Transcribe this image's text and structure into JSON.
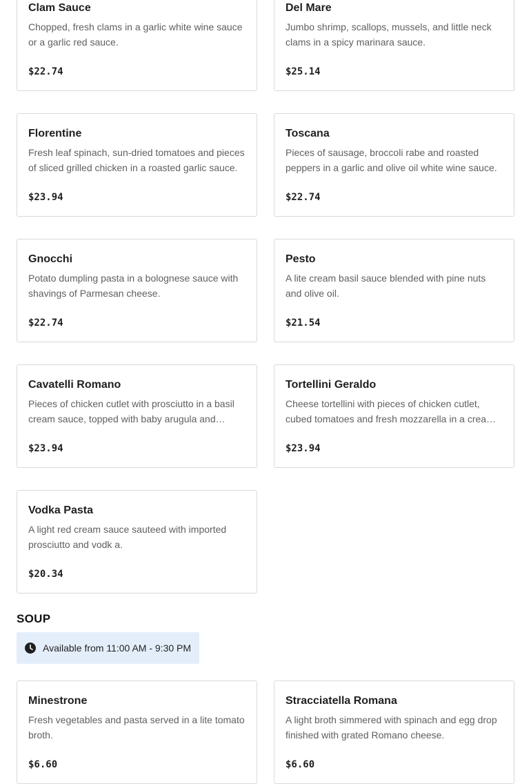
{
  "pasta_items": [
    {
      "name": "Clam Sauce",
      "description": "Chopped, fresh clams in a garlic white wine sauce or a garlic red sauce.",
      "price": "$22.74"
    },
    {
      "name": "Del Mare",
      "description": "Jumbo shrimp, scallops, mussels, and little neck clams in a spicy marinara sauce.",
      "price": "$25.14"
    },
    {
      "name": "Florentine",
      "description": "Fresh leaf spinach, sun-dried tomatoes and pieces of sliced grilled chicken in a roasted garlic sauce.",
      "price": "$23.94"
    },
    {
      "name": "Toscana",
      "description": "Pieces of sausage, broccoli rabe and roasted peppers in a garlic and olive oil white wine sauce.",
      "price": "$22.74"
    },
    {
      "name": "Gnocchi",
      "description": "Potato dumpling pasta in a bolognese sauce with shavings of Parmesan cheese.",
      "price": "$22.74"
    },
    {
      "name": "Pesto",
      "description": "A lite cream basil sauce blended with pine nuts and olive oil.",
      "price": "$21.54"
    },
    {
      "name": "Cavatelli Romano",
      "description": "Pieces of chicken cutlet with prosciutto in a basil cream sauce, topped with baby arugula and shaved Parmesan.",
      "price": "$23.94"
    },
    {
      "name": "Tortellini Geraldo",
      "description": "Cheese tortellini with pieces of chicken cutlet, cubed tomatoes and fresh mozzarella in a cream sauce.",
      "price": "$23.94"
    },
    {
      "name": "Vodka Pasta",
      "description": "A light red cream sauce sauteed with imported prosciutto and vodk a.",
      "price": "$20.34"
    }
  ],
  "soup_section": {
    "title": "SOUP",
    "availability": "Available from 11:00 AM - 9:30 PM",
    "icon": "clock-icon"
  },
  "soup_items": [
    {
      "name": "Minestrone",
      "description": "Fresh vegetables and pasta served in a lite tomato broth.",
      "price": "$6.60"
    },
    {
      "name": "Stracciatella Romana",
      "description": "A light broth simmered with spinach and egg drop finished with grated Romano cheese.",
      "price": "$6.60"
    }
  ]
}
